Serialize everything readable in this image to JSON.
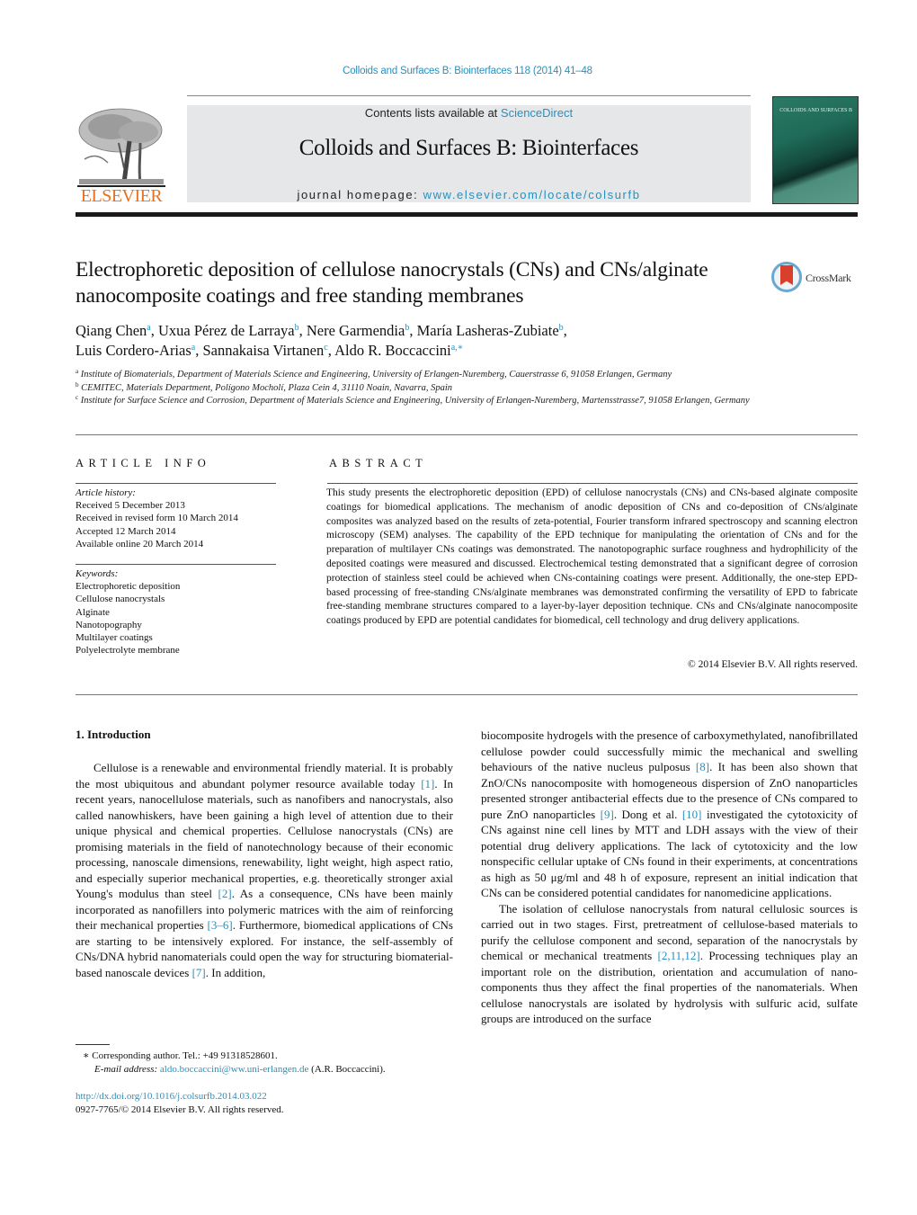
{
  "header": {
    "journal_reference": "Colloids and Surfaces B: Biointerfaces 118 (2014) 41–48",
    "contents_prefix": "Contents lists available at ",
    "contents_link": "ScienceDirect",
    "journal_title": "Colloids and Surfaces B: Biointerfaces",
    "homepage_prefix": "journal homepage: ",
    "homepage_link": "www.elsevier.com/locate/colsurfb",
    "publisher_name": "ELSEVIER",
    "cover_title": "COLLOIDS AND SURFACES B",
    "publisher_color": "#e9711c",
    "link_color": "#2a8fbd"
  },
  "article": {
    "title": "Electrophoretic deposition of cellulose nanocrystals (CNs) and CNs/alginate nanocomposite coatings and free standing membranes",
    "crossmark_label": "CrossMark",
    "authors": [
      {
        "name": "Qiang Chen",
        "aff": "a",
        "sep": ", "
      },
      {
        "name": "Uxua Pérez de Larraya",
        "aff": "b",
        "sep": ", "
      },
      {
        "name": "Nere Garmendia",
        "aff": "b",
        "sep": ", "
      },
      {
        "name": "María Lasheras-Zubiate",
        "aff": "b",
        "sep": ","
      },
      {
        "name": "Luis Cordero-Arias",
        "aff": "a",
        "sep": ", "
      },
      {
        "name": "Sannakaisa Virtanen",
        "aff": "c",
        "sep": ", "
      },
      {
        "name": "Aldo R. Boccaccini",
        "aff": "a,∗",
        "sep": ""
      }
    ],
    "affiliations": [
      {
        "key": "a",
        "text": "Institute of Biomaterials, Department of Materials Science and Engineering, University of Erlangen-Nuremberg, Cauerstrasse 6, 91058 Erlangen, Germany"
      },
      {
        "key": "b",
        "text": "CEMITEC, Materials Department, Polígono Mocholí, Plaza Cein 4, 31110 Noain, Navarra, Spain"
      },
      {
        "key": "c",
        "text": "Institute for Surface Science and Corrosion, Department of Materials Science and Engineering, University of Erlangen-Nuremberg, Martensstrasse7, 91058 Erlangen, Germany"
      }
    ]
  },
  "article_info": {
    "heading": "ARTICLE INFO",
    "history_label": "Article history:",
    "history": [
      "Received 5 December 2013",
      "Received in revised form 10 March 2014",
      "Accepted 12 March 2014",
      "Available online 20 March 2014"
    ],
    "keywords_label": "Keywords:",
    "keywords": [
      "Electrophoretic deposition",
      "Cellulose nanocrystals",
      "Alginate",
      "Nanotopography",
      "Multilayer coatings",
      "Polyelectrolyte membrane"
    ]
  },
  "abstract": {
    "heading": "ABSTRACT",
    "text": "This study presents the electrophoretic deposition (EPD) of cellulose nanocrystals (CNs) and CNs-based alginate composite coatings for biomedical applications. The mechanism of anodic deposition of CNs and co-deposition of CNs/alginate composites was analyzed based on the results of zeta-potential, Fourier transform infrared spectroscopy and scanning electron microscopy (SEM) analyses. The capability of the EPD technique for manipulating the orientation of CNs and for the preparation of multilayer CNs coatings was demonstrated. The nanotopographic surface roughness and hydrophilicity of the deposited coatings were measured and discussed. Electrochemical testing demonstrated that a significant degree of corrosion protection of stainless steel could be achieved when CNs-containing coatings were present. Additionally, the one-step EPD-based processing of free-standing CNs/alginate membranes was demonstrated confirming the versatility of EPD to fabricate free-standing membrane structures compared to a layer-by-layer deposition technique. CNs and CNs/alginate nanocomposite coatings produced by EPD are potential candidates for biomedical, cell technology and drug delivery applications.",
    "copyright": "© 2014 Elsevier B.V. All rights reserved."
  },
  "introduction": {
    "heading": "1.  Introduction",
    "left_paragraph": [
      {
        "t": "Cellulose is a renewable and environmental friendly material. It is probably the most ubiquitous and abundant polymer resource available today "
      },
      {
        "ref": "[1]"
      },
      {
        "t": ". In recent years, nanocellulose materials, such as nanofibers and nanocrystals, also called nanowhiskers, have been gaining a high level of attention due to their unique physical and chemical properties. Cellulose nanocrystals (CNs) are promising materials in the field of nanotechnology because of their economic processing, nanoscale dimensions, renewability, light weight, high aspect ratio, and especially superior mechanical properties, e.g. theoretically stronger axial Young's modulus than steel "
      },
      {
        "ref": "[2]"
      },
      {
        "t": ". As a consequence, CNs have been mainly incorporated as nanofillers into polymeric matrices with the aim of reinforcing their mechanical properties "
      },
      {
        "ref": "[3–6]"
      },
      {
        "t": ". Furthermore, biomedical applications of CNs are starting to be intensively explored. For instance, the self-assembly of CNs/DNA hybrid nanomaterials could open the way for structuring biomaterial-based nanoscale devices "
      },
      {
        "ref": "[7]"
      },
      {
        "t": ". In addition,"
      }
    ],
    "right_paragraph_1": [
      {
        "t": "biocomposite hydrogels with the presence of carboxymethylated, nanofibrillated cellulose powder could successfully mimic the mechanical and swelling behaviours of the native nucleus pulposus "
      },
      {
        "ref": "[8]"
      },
      {
        "t": ". It has been also shown that ZnO/CNs nanocomposite with homogeneous dispersion of ZnO nanoparticles presented stronger antibacterial effects due to the presence of CNs compared to pure ZnO nanoparticles "
      },
      {
        "ref": "[9]"
      },
      {
        "t": ". Dong et al. "
      },
      {
        "ref": "[10]"
      },
      {
        "t": " investigated the cytotoxicity of CNs against nine cell lines by MTT and LDH assays with the view of their potential drug delivery applications. The lack of cytotoxicity and the low nonspecific cellular uptake of CNs found in their experiments, at concentrations as high as 50 μg/ml and 48 h of exposure, represent an initial indication that CNs can be considered potential candidates for nanomedicine applications."
      }
    ],
    "right_paragraph_2": [
      {
        "t": "The isolation of cellulose nanocrystals from natural cellulosic sources is carried out in two stages. First, pretreatment of cellulose-based materials to purify the cellulose component and second, separation of the nanocrystals by chemical or mechanical treatments "
      },
      {
        "ref": "[2,11,12]"
      },
      {
        "t": ". Processing techniques play an important role on the distribution, orientation and accumulation of nano-components thus they affect the final properties of the nanomaterials. When cellulose nanocrystals are isolated by hydrolysis with sulfuric acid, sulfate groups are introduced on the surface"
      }
    ]
  },
  "footnote": {
    "marker": "∗",
    "corresponding": "Corresponding author. Tel.: +49 91318528601.",
    "email_label": "E-mail address: ",
    "email": "aldo.boccaccini@ww.uni-erlangen.de",
    "email_suffix": " (A.R. Boccaccini).",
    "doi": "http://dx.doi.org/10.1016/j.colsurfb.2014.03.022",
    "issn_line": "0927-7765/© 2014 Elsevier B.V. All rights reserved."
  }
}
